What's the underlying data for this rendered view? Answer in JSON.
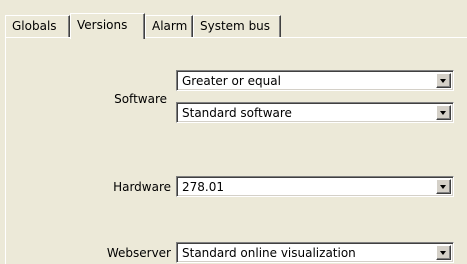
{
  "tabs": [
    "Globals",
    "Versions",
    "Alarm",
    "System bus"
  ],
  "active_tab": "Versions",
  "software": {
    "label": "Software",
    "comparison": "Greater or equal",
    "type": "Standard software"
  },
  "hardware": {
    "label": "Hardware",
    "value": "278.01"
  },
  "webserver": {
    "label": "Webserver",
    "value": "Standard online visualization"
  }
}
